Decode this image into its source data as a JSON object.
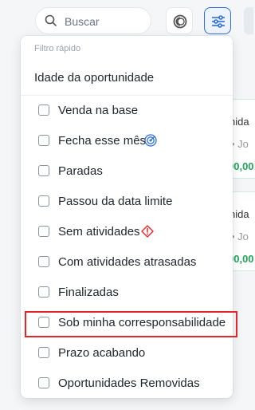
{
  "search": {
    "placeholder": "Buscar"
  },
  "toolbar": {
    "view_toggle_icon": "circle-half-icon",
    "filter_icon": "sliders-icon",
    "accent": "#2f6fd6"
  },
  "background_cards": [
    {
      "title": "nida",
      "subtitle": "• Jo",
      "value": "00,00"
    },
    {
      "title": "nida",
      "subtitle": "• Jo",
      "value": "00,00"
    }
  ],
  "dropdown": {
    "section_label": "Filtro rápido",
    "header_item": "Idade da oportunidade",
    "items": [
      {
        "label": "Venda na base",
        "checked": false
      },
      {
        "label": "Fecha esse mês",
        "checked": false,
        "icon": "target-icon"
      },
      {
        "label": "Paradas",
        "checked": false
      },
      {
        "label": "Passou da data limite",
        "checked": false
      },
      {
        "label": "Sem atividades",
        "checked": false,
        "icon": "warning-diamond-icon"
      },
      {
        "label": "Com atividades atrasadas",
        "checked": false
      },
      {
        "label": "Finalizadas",
        "checked": false
      },
      {
        "label": "Sob minha corresponsabilidade",
        "checked": false,
        "highlighted": true
      },
      {
        "label": "Prazo acabando",
        "checked": false
      },
      {
        "label": "Oportunidades Removidas",
        "checked": false
      }
    ]
  },
  "colors": {
    "highlight": "#e2262b",
    "success": "#22a55b",
    "warning": "#e2262b",
    "info": "#2f6fd6"
  }
}
